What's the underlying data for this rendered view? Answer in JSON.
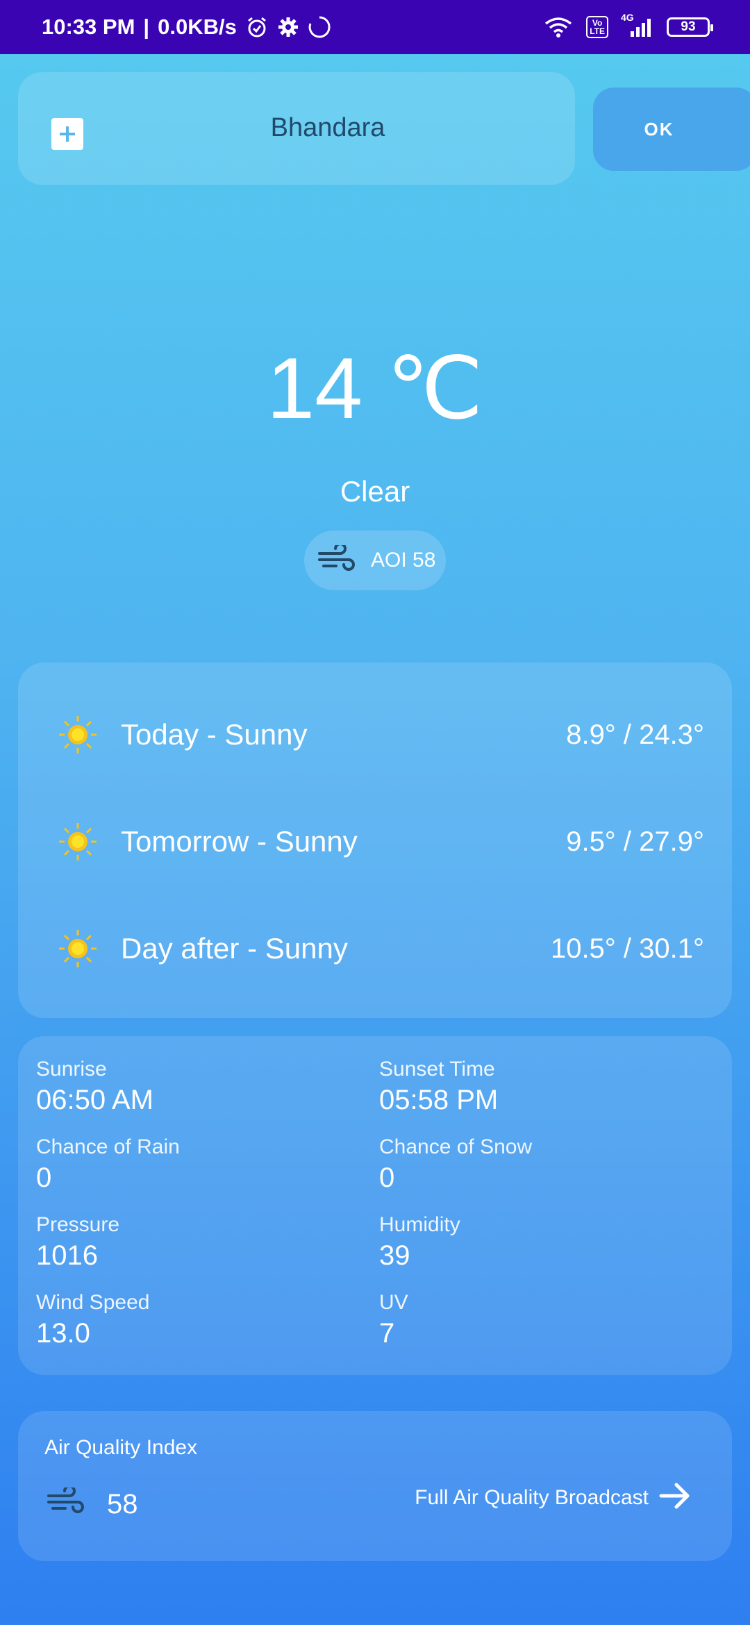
{
  "status_bar": {
    "time": "10:33 PM",
    "separator": "|",
    "network_speed": "0.0KB/s",
    "left_icons": [
      "alarm-icon",
      "gear-icon",
      "loading-icon"
    ],
    "right_icons": [
      "wifi-icon",
      "volte-icon",
      "signal-icon",
      "battery-icon"
    ],
    "volte_label": "Vo\nLTE",
    "network_type": "4G",
    "battery_level": "93"
  },
  "search": {
    "add_icon": "plus-icon",
    "city_value": "Bhandara",
    "ok_label": "OK"
  },
  "current": {
    "temperature": "14 ℃",
    "condition": "Clear",
    "aqi_icon": "wind-icon",
    "aqi_label": "AOI 58"
  },
  "forecast": [
    {
      "icon": "sun-icon",
      "label": "Today - Sunny",
      "temps": "8.9° / 24.3°"
    },
    {
      "icon": "sun-icon",
      "label": "Tomorrow - Sunny",
      "temps": "9.5° / 27.9°"
    },
    {
      "icon": "sun-icon",
      "label": "Day after - Sunny",
      "temps": "10.5° / 30.1°"
    }
  ],
  "details": [
    {
      "label": "Sunrise",
      "value": "06:50 AM"
    },
    {
      "label": "Sunset Time",
      "value": "05:58 PM"
    },
    {
      "label": "Chance of Rain",
      "value": "0"
    },
    {
      "label": "Chance of Snow",
      "value": "0"
    },
    {
      "label": "Pressure",
      "value": "1016"
    },
    {
      "label": "Humidity",
      "value": "39"
    },
    {
      "label": "Wind Speed",
      "value": "13.0"
    },
    {
      "label": "UV",
      "value": "7"
    }
  ],
  "air_quality": {
    "title": "Air Quality Index",
    "icon": "wind-icon",
    "value": "58",
    "link_label": "Full Air Quality Broadcast",
    "link_icon": "arrow-right-icon"
  },
  "colors": {
    "status_bar": "#3a04b3",
    "gradient_top": "#56cbef",
    "gradient_bottom": "#2e7ff0",
    "ok_button": "#4aa6ea",
    "city_text": "#1f4a6b",
    "sun": "#f7c21b",
    "wind_icon": "#23496a"
  }
}
